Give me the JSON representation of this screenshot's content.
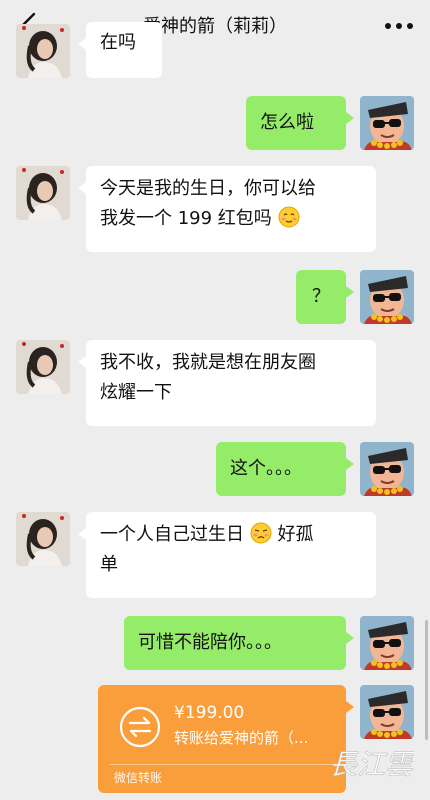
{
  "nav": {
    "title": "爱神的箭（莉莉）",
    "back_icon": "chevron-left-icon",
    "more_icon": "more-dots-icon"
  },
  "messages": [
    {
      "from": "other",
      "text": "在吗"
    },
    {
      "from": "me",
      "text": "怎么啦"
    },
    {
      "from": "other",
      "line1": "今天是我的生日，你可以给",
      "line2": "我发一个 199 红包吗",
      "emoji": "smiling-blush-emoji"
    },
    {
      "from": "me",
      "text": "？"
    },
    {
      "from": "other",
      "line1": "我不收，我就是想在朋友圈",
      "line2": "炫耀一下"
    },
    {
      "from": "me",
      "text": "这个。。。"
    },
    {
      "from": "other",
      "line1a": "一个人自己过生日",
      "line1b": "好孤",
      "line2": "单",
      "emoji": "sad-face-emoji"
    },
    {
      "from": "me",
      "text": "可惜不能陪你。。。"
    }
  ],
  "transfer": {
    "amount": "¥199.00",
    "description": "转账给爱神的箭（...",
    "footer": "微信转账",
    "color": "#fa9d3b"
  },
  "watermark": {
    "text": "長江雲"
  },
  "colors": {
    "background": "#ededed",
    "bubble_me": "#95ec69",
    "bubble_other": "#ffffff"
  }
}
